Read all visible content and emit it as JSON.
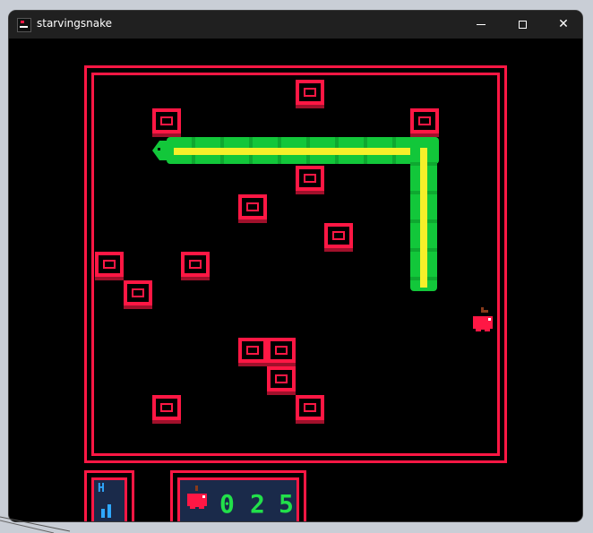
{
  "window": {
    "title": "starvingsnake",
    "controls": {
      "minimize": "minimize",
      "maximize": "maximize",
      "close": "✕"
    }
  },
  "game": {
    "score_digits": [
      "0",
      "2",
      "5"
    ],
    "level_label": "H",
    "colors": {
      "wall": "#ff1744",
      "snake_body": "#12c73a",
      "snake_core": "#f5f02a",
      "apple": "#ff1744",
      "score": "#22e04a",
      "hud_bg": "#1a2a4a",
      "level": "#2fa8ff"
    }
  }
}
